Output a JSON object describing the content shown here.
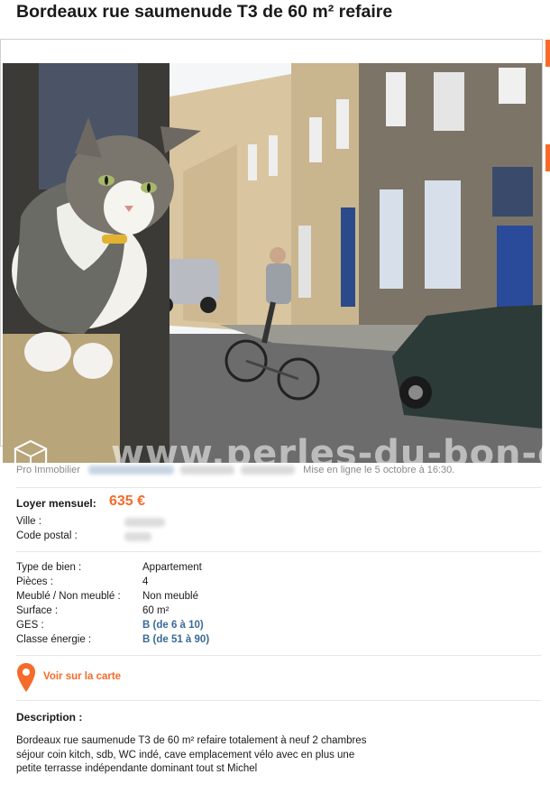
{
  "ad": {
    "title": "Bordeaux rue saumenude T3 de 60 m² refaire",
    "watermark": "www.perles-du-bon-coin.fr",
    "seller_type": "Pro Immobilier",
    "posted": "Mise en ligne le 5 octobre à 16:30.",
    "price_label": "Loyer mensuel:",
    "price": "635 €",
    "ville_label": "Ville :",
    "cp_label": "Code postal :",
    "details": [
      {
        "label": "Type de bien :",
        "value": "Appartement"
      },
      {
        "label": "Pièces :",
        "value": "4"
      },
      {
        "label": "Meublé / Non meublé :",
        "value": "Non meublé"
      },
      {
        "label": "Surface :",
        "value": "60 m²"
      },
      {
        "label": "GES :",
        "value": "B (de 6 à 10)"
      },
      {
        "label": "Classe énergie :",
        "value": "B (de 51 à 90)"
      }
    ],
    "map_link": "Voir sur la carte",
    "description_title": "Description :",
    "description": "Bordeaux rue saumenude T3 de 60 m² refaire totalement à neuf 2 chambres séjour coin kitch, sdb, WC indé, cave emplacement vélo avec en plus une petite terrasse indépendante dominant tout st Michel"
  },
  "colors": {
    "accent": "#f56b2a",
    "link": "#3a6a96"
  },
  "icons": {
    "logo": "lbc-cube-logo",
    "pin": "map-pin-icon"
  }
}
